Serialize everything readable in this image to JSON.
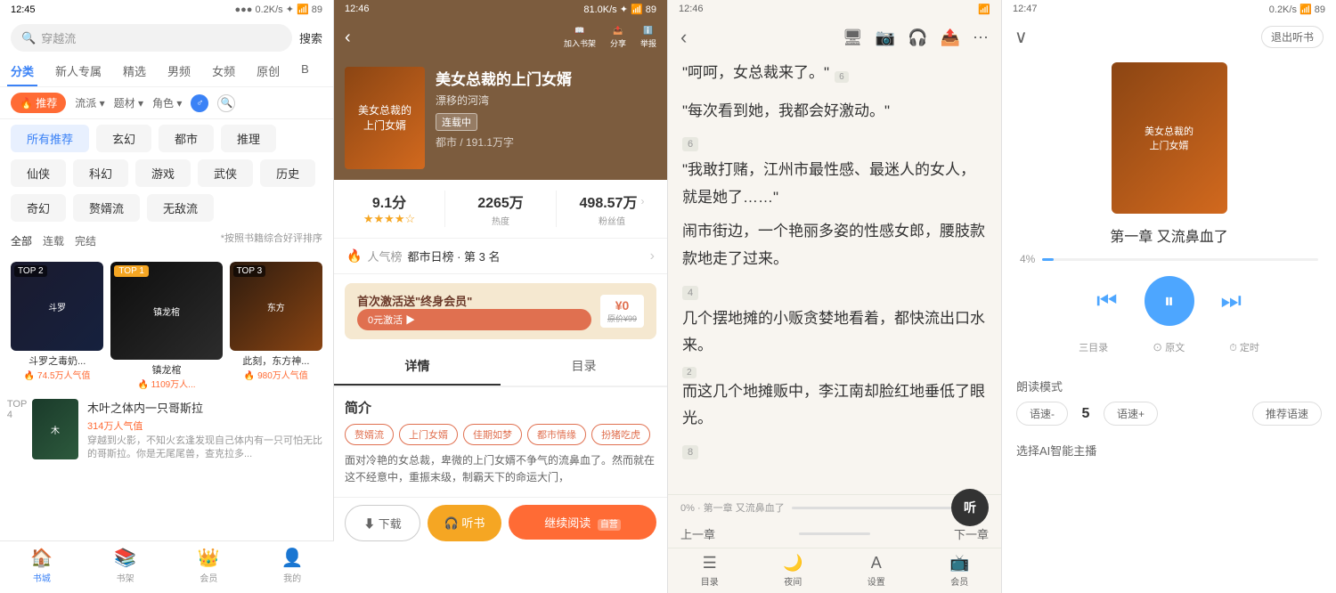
{
  "panel1": {
    "status": {
      "time": "12:45",
      "network": "0.2K/s",
      "battery": "89"
    },
    "search": {
      "placeholder": "穿越流",
      "btn": "搜索"
    },
    "tabs": [
      {
        "id": "fenlei",
        "label": "分类",
        "active": true
      },
      {
        "id": "xinren",
        "label": "新人专属",
        "active": false
      },
      {
        "id": "jingxuan",
        "label": "精选",
        "active": false
      },
      {
        "id": "nanpin",
        "label": "男频",
        "active": false
      },
      {
        "id": "nvpin",
        "label": "女频",
        "active": false
      },
      {
        "id": "yuanchuang",
        "label": "原创",
        "active": false
      },
      {
        "id": "more",
        "label": "B",
        "active": false
      }
    ],
    "filter_row1": [
      {
        "label": "推荐",
        "active": true,
        "icon": "🔥"
      },
      {
        "label": "流派",
        "active": false
      },
      {
        "label": "题材",
        "active": false
      },
      {
        "label": "角色",
        "active": false
      },
      {
        "label": "♂",
        "active": false,
        "circle": true
      },
      {
        "label": "🔍",
        "active": false,
        "circle": true
      }
    ],
    "filter_tags": [
      {
        "label": "所有推荐",
        "active": true
      },
      {
        "label": "玄幻",
        "active": false
      },
      {
        "label": "都市",
        "active": false
      },
      {
        "label": "推理",
        "active": false
      },
      {
        "label": "仙侠",
        "active": false
      },
      {
        "label": "科幻",
        "active": false
      },
      {
        "label": "游戏",
        "active": false
      },
      {
        "label": "武侠",
        "active": false
      },
      {
        "label": "历史",
        "active": false
      },
      {
        "label": "奇幻",
        "active": false
      },
      {
        "label": "赘婿流",
        "active": false
      },
      {
        "label": "无敌流",
        "active": false
      }
    ],
    "sort_tabs": [
      {
        "label": "全部",
        "active": true
      },
      {
        "label": "连载",
        "active": false
      },
      {
        "label": "完结",
        "active": false
      }
    ],
    "sort_hint": "*按照书籍综合好评排序",
    "top_books": [
      {
        "rank": "TOP 2",
        "title": "斗罗之毒奶...",
        "popularity": "74.5万人气值",
        "color1": "#1a1a2e",
        "color2": "#16213e"
      },
      {
        "rank": "TOP 1",
        "title": "镇龙棺",
        "popularity": "1109万人...",
        "color1": "#0d0d0d",
        "color2": "#2c2c2c"
      },
      {
        "rank": "TOP 3",
        "title": "此刻，东方神...",
        "popularity": "980万人气值",
        "color1": "#2d1b0e",
        "color2": "#8b4513"
      }
    ],
    "list_books": [
      {
        "rank": "TOP 4",
        "title": "木叶之体内一只哥斯拉",
        "popularity": "314万人气值",
        "desc": "穿越到火影，不知火玄逢发现自己体内有一只可怕无比的哥斯拉。你是无尾尾兽，查克拉多...",
        "color1": "#1a3a2a",
        "color2": "#2d5a3d"
      }
    ],
    "bottom_nav": [
      {
        "label": "书城",
        "icon": "🏠",
        "active": true
      },
      {
        "label": "书架",
        "icon": "📚",
        "active": false
      },
      {
        "label": "会员",
        "icon": "👑",
        "active": false
      },
      {
        "label": "我的",
        "icon": "👤",
        "active": false
      }
    ]
  },
  "panel2": {
    "status": {
      "time": "12:46",
      "network": "81.0K/s"
    },
    "header_icons": [
      {
        "label": "加入书架",
        "icon": "📖"
      },
      {
        "label": "分享",
        "icon": "📤"
      },
      {
        "label": "举报",
        "icon": "ℹ️"
      }
    ],
    "book": {
      "title": "美女总裁的上门女婿",
      "author": "漂移的河湾",
      "status": "连载中",
      "genre": "都市 / 191.1万字"
    },
    "stats": {
      "score": "9.1分",
      "stars": "★★★★★",
      "hot": "2265万",
      "hot_label": "热度",
      "fans": "498.57万",
      "fans_label": "粉丝值"
    },
    "rank": {
      "icon": "🔥",
      "label": "人气榜",
      "detail": "都市日榜 · 第 3 名"
    },
    "promo": {
      "title": "首次激活送\"终身会员\"",
      "btn": "0元激活 ▶",
      "price": "¥0",
      "note": "原价¥99"
    },
    "tabs": [
      {
        "label": "详情",
        "active": true
      },
      {
        "label": "目录",
        "active": false
      }
    ],
    "intro_title": "简介",
    "tags": [
      "赘婿流",
      "上门女婿",
      "佳期如梦",
      "都市情缘",
      "扮猪吃虎"
    ],
    "intro_text": "面对冷艳的女总裁，卑微的上门女婿不争气的流鼻血了。然而就在这不经意中，重振末级，制霸天下的命运大门，",
    "footer_btns": [
      {
        "label": "⬇ 下载",
        "type": "outline"
      },
      {
        "label": "🎧 听书",
        "type": "secondary"
      },
      {
        "label": "继续阅读",
        "type": "primary"
      }
    ],
    "self_label": "自营"
  },
  "panel3": {
    "status": {
      "time": "12:46"
    },
    "content": [
      {
        "type": "quote",
        "num": "6",
        "text": "\"呵呵，女总裁来了。\""
      },
      {
        "type": "quote",
        "text": "\"每次看到她，我都会好激动。\""
      },
      {
        "type": "chapter_num",
        "num": "6"
      },
      {
        "type": "text",
        "text": "\"我敢打赌，江州市最性感、最迷人的女人，就是她了……\""
      },
      {
        "type": "text",
        "text": "闹市街边，一个艳丽多姿的性感女郎，腰肢款款地走了过来。"
      },
      {
        "type": "chapter_num",
        "num": "4"
      },
      {
        "type": "text",
        "text": "几个摆地摊的小贩贪婪地看着，都快流出口水来。"
      },
      {
        "type": "num_badge",
        "num": "2"
      },
      {
        "type": "text",
        "text": "而这几个地摊贩中，李江南却脸红地垂低了眼光。"
      },
      {
        "type": "num_badge",
        "num": "8"
      }
    ],
    "progress": {
      "pct": "0%",
      "chapter": "第一章 又流鼻血了"
    },
    "bottom_nav": [
      {
        "label": "目录",
        "icon": "☰"
      },
      {
        "label": "夜间",
        "icon": "🌙"
      },
      {
        "label": "设置",
        "icon": "A"
      },
      {
        "label": "会员",
        "icon": "📺"
      }
    ],
    "listen_btn": "听"
  },
  "panel4": {
    "status": {
      "time": "12:47",
      "network": "0.2K/s"
    },
    "exit_btn": "退出听书",
    "chapter": "第一章 又流鼻血了",
    "progress_pct": "4%",
    "controls": [
      {
        "label": "三目录",
        "icon": "⏮"
      },
      {
        "label": "原文",
        "icon": "▶"
      },
      {
        "label": "定时",
        "icon": "⏭"
      }
    ],
    "reading_mode": "朗读模式",
    "speed_minus": "语速-",
    "speed_val": "5",
    "speed_plus": "语速+",
    "speed_recommend": "推荐语速",
    "ai_label": "选择AI智能主播",
    "ctrl_labels": [
      "三目录",
      "⊙ 原文",
      "⏱ 定时"
    ]
  }
}
